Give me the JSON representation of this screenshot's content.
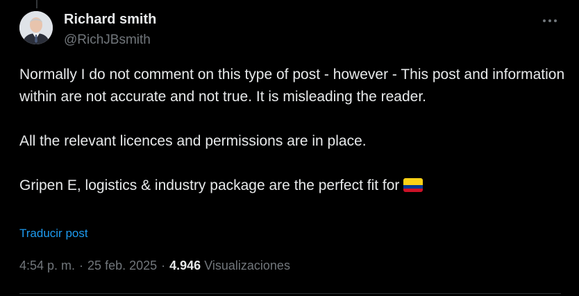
{
  "post": {
    "author": {
      "name": "Richard smith",
      "handle": "@RichJBsmith"
    },
    "text": {
      "paragraph_1": "Normally I do not comment on this type of post - however - This post and information within are not accurate and not true. It is misleading the reader.",
      "paragraph_2": "All the relevant licences and permissions are in place.",
      "paragraph_3": "Gripen E, logistics & industry package are the perfect fit for"
    },
    "flag_icon": "colombia-flag-icon",
    "translate_label": "Traducir post",
    "time": "4:54 p. m.",
    "date": "25 feb. 2025",
    "separator": "·",
    "views_count": "4.946",
    "views_label": "Visualizaciones",
    "more_icon": "more-horizontal-icon"
  },
  "colors": {
    "background": "#000000",
    "text_primary": "#e7e9ea",
    "text_secondary": "#71767b",
    "link": "#1d9bf0",
    "divider": "#2f3336"
  }
}
